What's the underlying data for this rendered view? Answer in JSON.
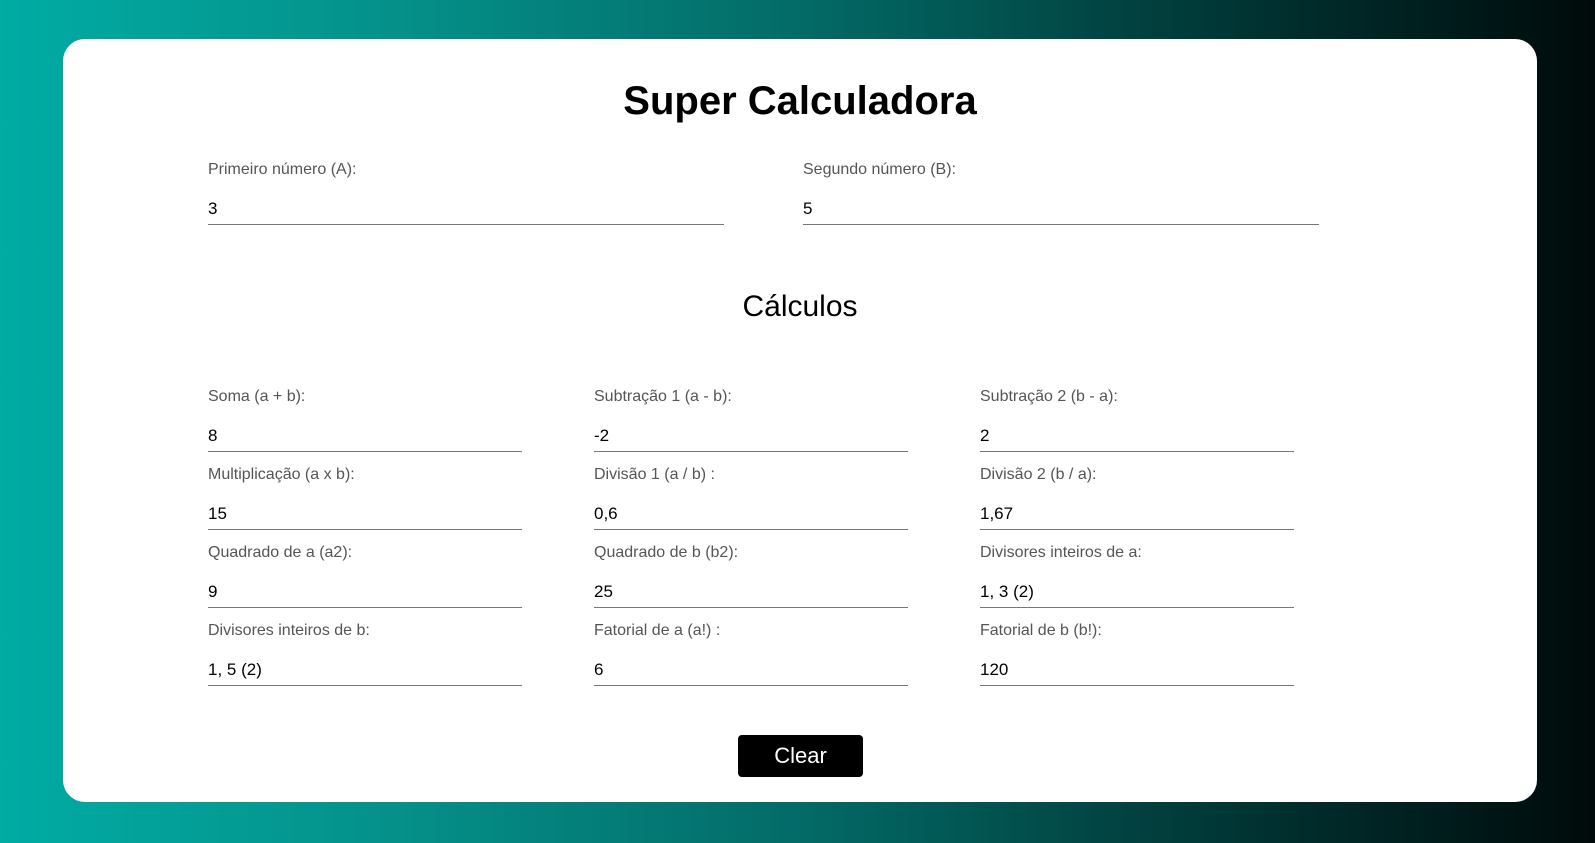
{
  "title": "Super Calculadora",
  "inputs": {
    "a": {
      "label": "Primeiro número (A):",
      "value": "3"
    },
    "b": {
      "label": "Segundo número (B):",
      "value": "5"
    }
  },
  "section_title": "Cálculos",
  "calcs": [
    {
      "label": "Soma (a + b):",
      "value": "8"
    },
    {
      "label": "Subtração 1 (a - b):",
      "value": "-2"
    },
    {
      "label": "Subtração 2 (b - a):",
      "value": "2"
    },
    {
      "label": "Multiplicação (a x b):",
      "value": "15"
    },
    {
      "label": "Divisão 1 (a / b) :",
      "value": "0,6"
    },
    {
      "label": "Divisão 2 (b / a):",
      "value": "1,67"
    },
    {
      "label": "Quadrado de a (a2):",
      "value": "9"
    },
    {
      "label": "Quadrado de b (b2):",
      "value": "25"
    },
    {
      "label": "Divisores inteiros de a:",
      "value": "1, 3 (2)"
    },
    {
      "label": "Divisores inteiros de b:",
      "value": "1, 5 (2)"
    },
    {
      "label": "Fatorial de a (a!) :",
      "value": "6"
    },
    {
      "label": "Fatorial de b (b!):",
      "value": "120"
    }
  ],
  "clear_label": "Clear",
  "colors": {
    "gradient_start": "#00aca3",
    "gradient_end": "#000a0a",
    "button_bg": "#000000",
    "label_text": "#555555"
  }
}
